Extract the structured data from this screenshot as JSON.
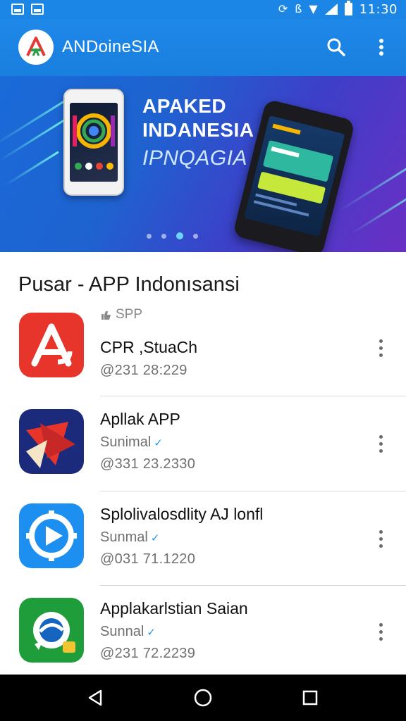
{
  "status_bar": {
    "time": "11:30",
    "left_icons": [
      "image-icon",
      "sim-icon"
    ],
    "right_icons": [
      "sync-icon",
      "vibrate-icon",
      "signal-icon",
      "battery-icon"
    ]
  },
  "app_bar": {
    "title": "ANDoineSIA",
    "search_icon": "search-icon",
    "menu_icon": "more-vert-icon"
  },
  "banner": {
    "line1": "APAKED",
    "line2": "INDANESIA",
    "line3": "IPNQAGIA",
    "slides": 4,
    "active_slide": 3
  },
  "section": {
    "title": "Pusar -  APP Indonısansi"
  },
  "apps": [
    {
      "tag": "SPP",
      "name": "CPR ,StuaCh",
      "subtitle": "",
      "date": "@231 28:229",
      "icon": "red-a-logo-icon",
      "color": "#e8352b"
    },
    {
      "tag": "",
      "name": "Apllak APP",
      "subtitle": "Sunimal",
      "date": "@331 23.2330",
      "icon": "red-star-logo-icon",
      "color": "#1b2a7a"
    },
    {
      "tag": "",
      "name": "Splolivalosdlity AJ lonfl",
      "subtitle": "Sunmal",
      "date": "@031 71.1220",
      "icon": "play-compass-icon",
      "color": "#1d8ff0"
    },
    {
      "tag": "",
      "name": "Applakarlstian Saian",
      "subtitle": "Sunnal",
      "date": "@231 72.2239",
      "icon": "chat-bubble-icon",
      "color": "#1f9d3a"
    }
  ],
  "nav_bar": {
    "back": "back-icon",
    "home": "home-icon",
    "recents": "recents-icon"
  }
}
